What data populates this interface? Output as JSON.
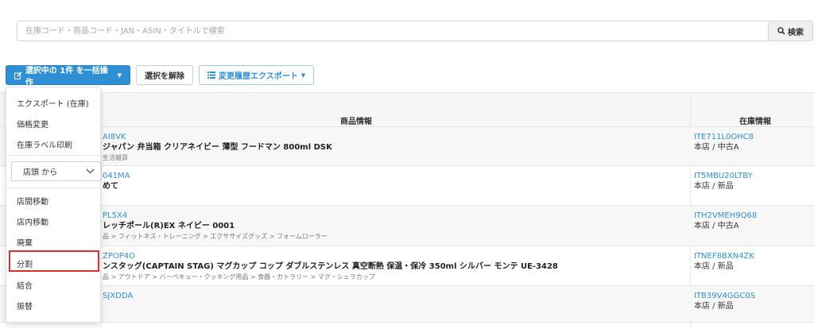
{
  "search": {
    "placeholder": "在庫コード・商品コード・JAN・ASIN・タイトルで検索",
    "button_label": "検索"
  },
  "toolbar": {
    "bulk_label": "選択中の 1件 を一括操作",
    "deselect_label": "選択を解除",
    "export_label": "変更履歴エクスポート"
  },
  "table": {
    "headers": {
      "product": "商品情報",
      "stock": "在庫情報"
    },
    "rows": [
      {
        "code": "AI8VK",
        "title": "ジャパン 弁当箱 クリアネイビー 薄型 フードマン 800ml DSK",
        "category": "生活雑貨",
        "stock_code": "ITE711L0OHC8",
        "stock_info": "本店 / 中古A"
      },
      {
        "code": "041MA",
        "title": "めて",
        "category": "",
        "stock_code": "IT5MBU20LTBY",
        "stock_info": "本店 / 新品"
      },
      {
        "code": "PL5X4",
        "title": "レッチポール(R)EX ネイビー 0001",
        "category": "品 > フィットネス・トレーニング > エクササイズグッズ > フォームローラー",
        "stock_code": "ITH2VMEH9Q68",
        "stock_info": "本店 / 中古A"
      },
      {
        "code": "ZPOP4O",
        "title": "ンスタッグ(CAPTAIN STAG) マグカップ コップ ダブルステンレス 真空断熱 保温・保冷 350ml シルバー モンテ UE-3428",
        "category": "品 > アウトドア > バーベキュー・クッキング用品 > 食器・カトラリー > マグ・シェラカップ",
        "stock_code": "ITNEF8BXN4ZK",
        "stock_info": "本店 / 新品"
      },
      {
        "code": "SJXDDA",
        "title": "",
        "category": "",
        "stock_code": "ITB39V4GGC0S",
        "stock_info": "本店 / 新品"
      }
    ]
  },
  "dropdown": {
    "items_top": [
      "エクスポート (在庫)",
      "価格変更",
      "在庫ラベル印刷"
    ],
    "select_value": "店頭 から",
    "items_bottom": [
      "店間移動",
      "店内移動",
      "廃棄",
      "分割",
      "結合",
      "振替"
    ],
    "highlight_color": "#d93030"
  },
  "colors": {
    "primary": "#2f8fd5",
    "link": "#2f8fd5"
  }
}
